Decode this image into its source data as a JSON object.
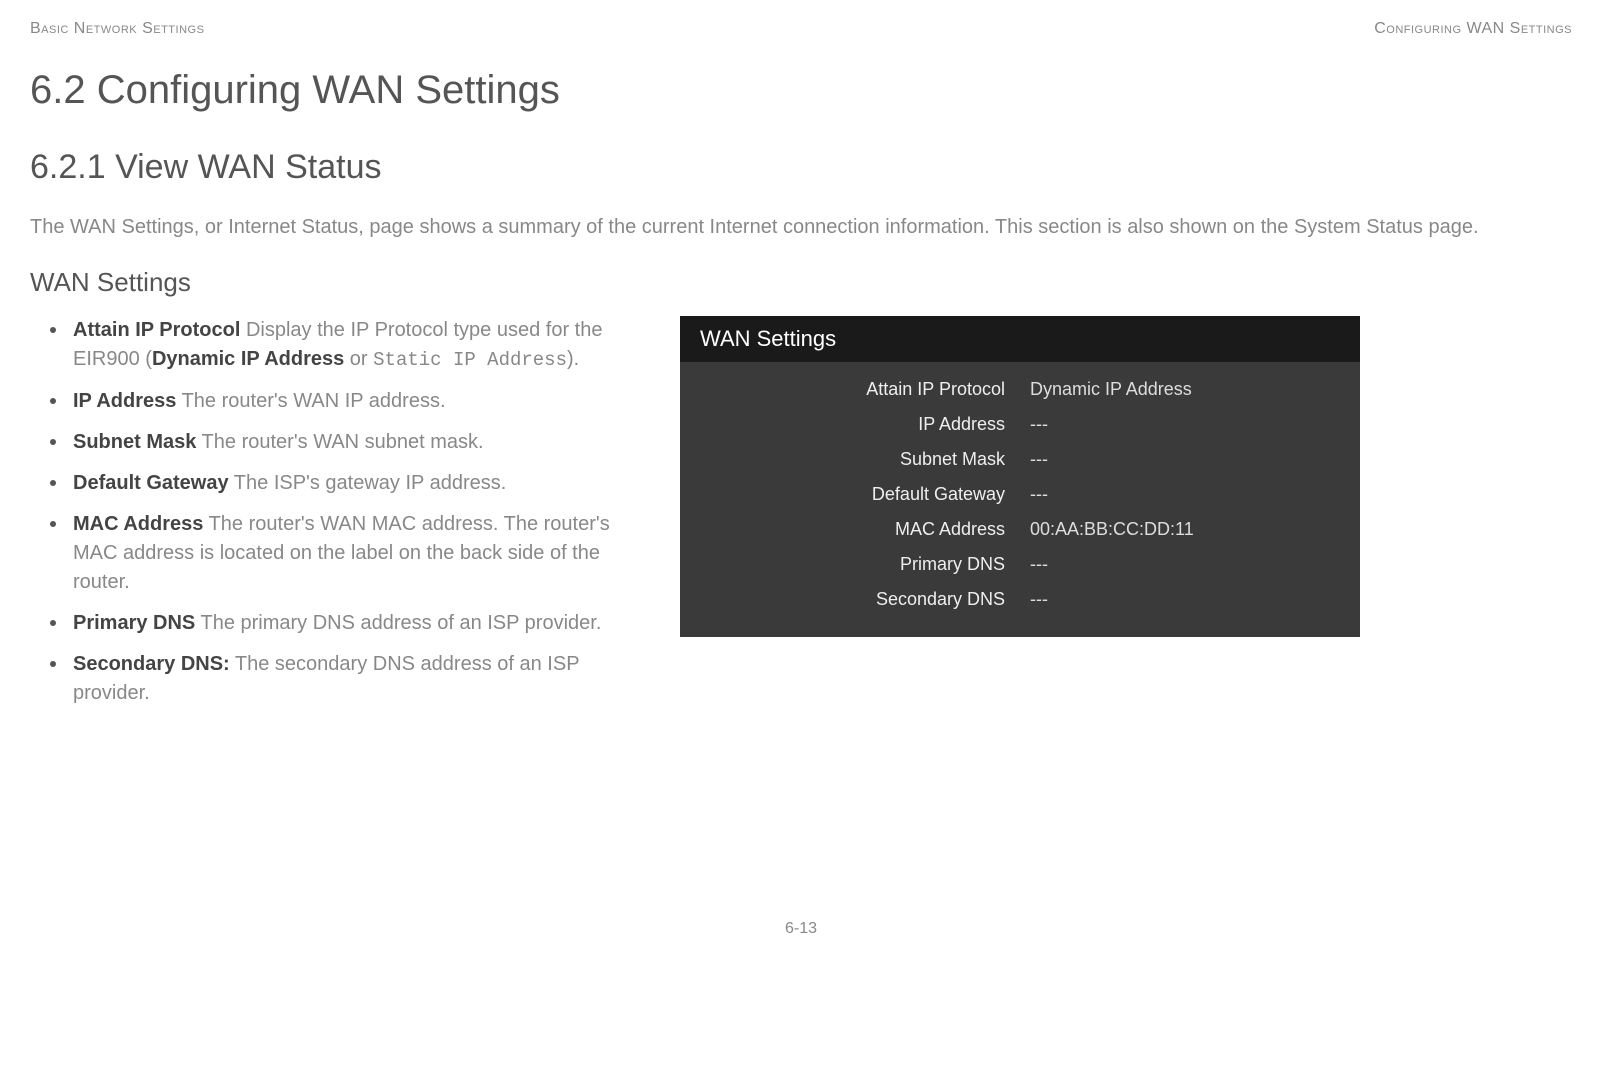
{
  "header": {
    "left": "Basic Network Settings",
    "right": "Configuring WAN Settings"
  },
  "section_title": "6.2 Configuring WAN Settings",
  "subsection_title": "6.2.1 View WAN Status",
  "intro_text": "The WAN Settings, or Internet Status, page shows a summary of the current Internet connection information. This section is also shown on the System Status page.",
  "subheading": "WAN Settings",
  "bullets": {
    "b0_term": "Attain IP Protocol",
    "b0_desc_a": "  Display the IP Protocol type used for the EIR900 (",
    "b0_desc_bold": "Dynamic IP Address",
    "b0_desc_b": " or ",
    "b0_desc_mono": "Static IP Address",
    "b0_desc_c": ").",
    "b1_term": "IP Address",
    "b1_desc": "  The router's WAN IP address.",
    "b2_term": "Subnet Mask",
    "b2_desc": "  The router's WAN subnet mask.",
    "b3_term": "Default Gateway",
    "b3_desc": "  The ISP's gateway IP address.",
    "b4_term": "MAC Address",
    "b4_desc": "  The router's WAN MAC address. The router's MAC address is located on the label on the back side of the router.",
    "b5_term": "Primary DNS",
    "b5_desc": "  The primary DNS address of an ISP provider.",
    "b6_term": "Secondary DNS:",
    "b6_desc": " The secondary DNS address of an ISP provider."
  },
  "wan_panel": {
    "title": "WAN Settings",
    "rows": [
      {
        "label": "Attain IP Protocol",
        "value": "Dynamic IP Address"
      },
      {
        "label": "IP Address",
        "value": "---"
      },
      {
        "label": "Subnet Mask",
        "value": "---"
      },
      {
        "label": "Default Gateway",
        "value": "---"
      },
      {
        "label": "MAC Address",
        "value": "00:AA:BB:CC:DD:11"
      },
      {
        "label": "Primary DNS",
        "value": "---"
      },
      {
        "label": "Secondary DNS",
        "value": "---"
      }
    ]
  },
  "footer": "6-13"
}
